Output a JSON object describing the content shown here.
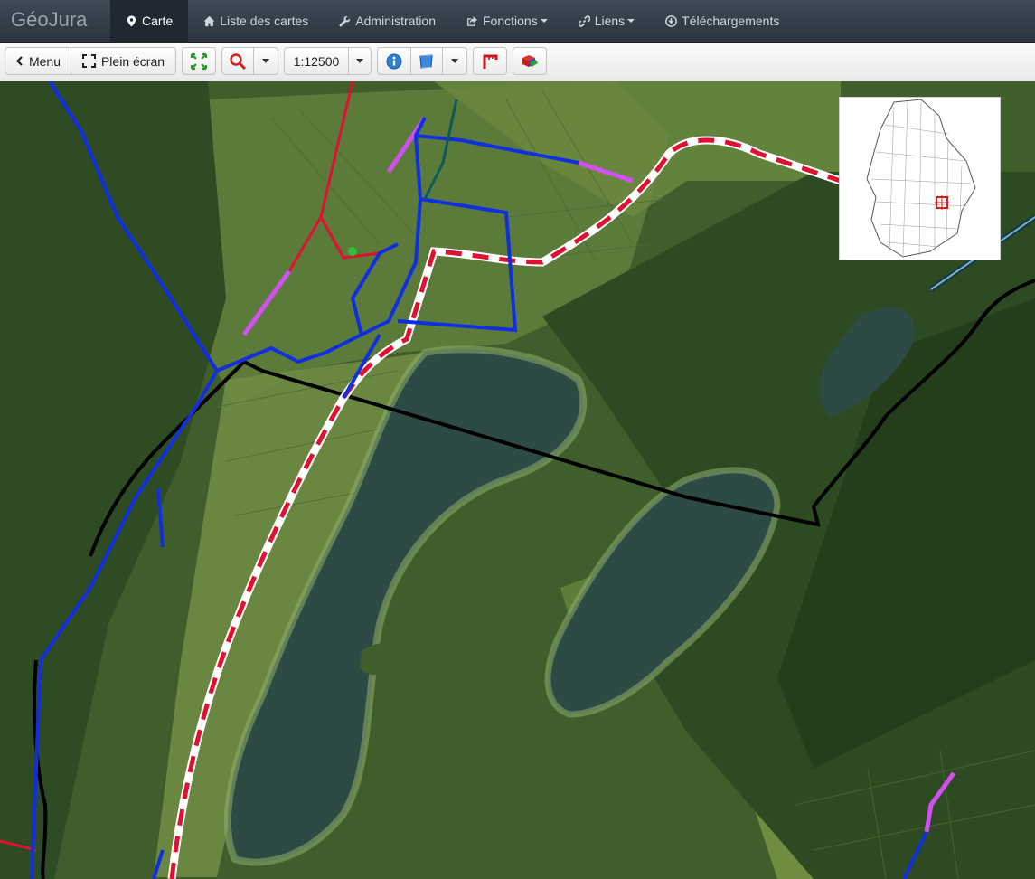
{
  "app": {
    "brand": "GéoJura"
  },
  "nav": {
    "items": [
      {
        "label": "Carte",
        "icon": "map-marker-icon",
        "active": true
      },
      {
        "label": "Liste des cartes",
        "icon": "home-icon"
      },
      {
        "label": "Administration",
        "icon": "wrench-icon"
      },
      {
        "label": "Fonctions",
        "icon": "share-icon",
        "dropdown": true
      },
      {
        "label": "Liens",
        "icon": "link-icon",
        "dropdown": true
      },
      {
        "label": "Téléchargements",
        "icon": "download-icon"
      }
    ]
  },
  "toolbar": {
    "menu_label": "Menu",
    "fullscreen_label": "Plein écran",
    "scale_label": "1:12500"
  },
  "colors": {
    "nav_bg": "#2b3540",
    "nav_active": "#1f2830",
    "network_blue": "#1030e0",
    "network_red": "#e01030",
    "network_magenta": "#d050f0",
    "boundary_black": "#000000",
    "lake": "#2e4a44"
  }
}
